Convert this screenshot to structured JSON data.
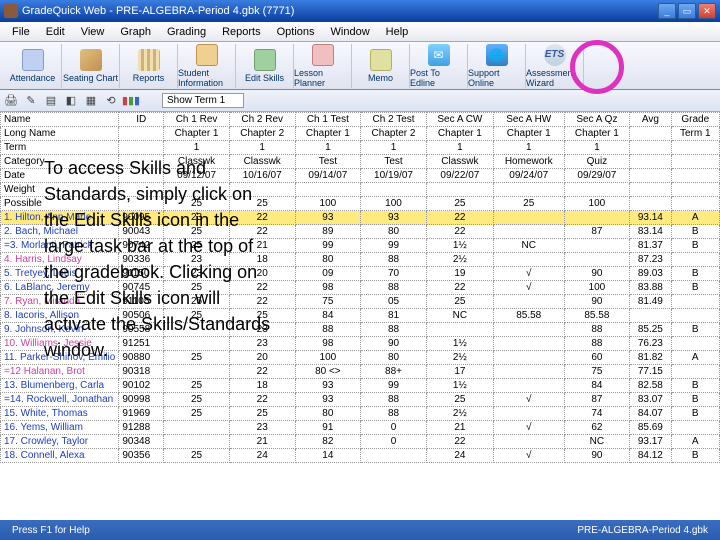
{
  "window": {
    "title": "GradeQuick Web - PRE-ALGEBRA-Period 4.gbk (7771)"
  },
  "menu": [
    "File",
    "Edit",
    "View",
    "Graph",
    "Grading",
    "Reports",
    "Options",
    "Window",
    "Help"
  ],
  "toolbar": [
    {
      "label": "Attendance",
      "icon": "cal",
      "name": "attendance-button"
    },
    {
      "label": "Seating Chart",
      "icon": "chart",
      "name": "seating-chart-button"
    },
    {
      "label": "Reports",
      "icon": "reports",
      "name": "reports-button"
    },
    {
      "label": "Student Information",
      "icon": "student",
      "name": "student-info-button"
    },
    {
      "label": "Edit Skills",
      "icon": "edit",
      "name": "edit-skills-button"
    },
    {
      "label": "Lesson Planner",
      "icon": "lesson",
      "name": "lesson-planner-button"
    },
    {
      "label": "Memo",
      "icon": "memo",
      "name": "memo-button"
    },
    {
      "label": "Post To Edline",
      "icon": "post",
      "name": "post-edline-button"
    },
    {
      "label": "Support Online",
      "icon": "support",
      "name": "support-online-button"
    },
    {
      "label": "Assessment Wizard",
      "icon": "ets",
      "name": "assessment-wizard-button"
    }
  ],
  "term_selector": "Show Term 1",
  "row_headers": [
    "Name",
    "Long Name",
    "Term",
    "Category",
    "Date",
    "Weight",
    "Possible"
  ],
  "columns": [
    "",
    "ID",
    "Ch 1 Rev",
    "Ch 2 Rev",
    "Ch 1 Test",
    "Ch 2 Test",
    "Sec A CW",
    "Sec A HW",
    "Sec A Qz",
    "Avg",
    "Grade"
  ],
  "sub_columns": [
    "",
    "",
    "Chapter 1",
    "Chapter 2",
    "Chapter 1",
    "Chapter 2",
    "Chapter 1",
    "Chapter 1",
    "Chapter 1",
    "",
    "Term 1"
  ],
  "meta_rows": [
    {
      "label": "Term",
      "cells": [
        "",
        "1",
        "1",
        "1",
        "1",
        "1",
        "1",
        "1",
        "",
        ""
      ]
    },
    {
      "label": "Category",
      "cells": [
        "",
        "Classwk",
        "Classwk",
        "Test",
        "Test",
        "Classwk",
        "Homework",
        "Quiz",
        "",
        ""
      ]
    },
    {
      "label": "Date",
      "cells": [
        "",
        "09/12/07",
        "10/16/07",
        "09/14/07",
        "10/19/07",
        "09/22/07",
        "09/24/07",
        "09/29/07",
        "",
        ""
      ]
    },
    {
      "label": "Weight",
      "cells": [
        "",
        "",
        "",
        "",
        "",
        "",
        "",
        "",
        "",
        ""
      ]
    },
    {
      "label": "Possible",
      "cells": [
        "",
        "25",
        "25",
        "100",
        "100",
        "25",
        "25",
        "100",
        "",
        ""
      ]
    }
  ],
  "students": [
    {
      "n": "1.",
      "name": "Hilton, Ann Marie",
      "id": "90095",
      "s": [
        "23",
        "22",
        "93",
        "93",
        "22",
        "",
        "",
        "93.14",
        "A"
      ],
      "hl": true
    },
    {
      "n": "2.",
      "name": "Bach, Michael",
      "id": "90043",
      "s": [
        "25",
        "22",
        "89",
        "80",
        "22",
        "",
        "87",
        "83.14",
        "B"
      ]
    },
    {
      "n": "=3.",
      "name": "Morlanti, Patrick",
      "id": "90742",
      "s": [
        "25",
        "21",
        "99",
        "99",
        "1½",
        "NC",
        "",
        "81.37",
        "B"
      ]
    },
    {
      "n": "4.",
      "name": "Harris, Lindsay",
      "id": "90336",
      "s": [
        "23",
        "18",
        "80",
        "88",
        "2½",
        "",
        "",
        "87.23",
        "",
        "pink"
      ]
    },
    {
      "n": "5.",
      "name": "Tretyey, Louis",
      "id": "91150",
      "s": [
        "23",
        "20",
        "09",
        "70",
        "19",
        "√",
        "90",
        "89.03",
        "B"
      ]
    },
    {
      "n": "6.",
      "name": "LaBlanc, Jeremy",
      "id": "90745",
      "s": [
        "25",
        "22",
        "98",
        "88",
        "22",
        "√",
        "100",
        "83.88",
        "B"
      ]
    },
    {
      "n": "7.",
      "name": "Ryan, Miranda",
      "id": "91105",
      "s": [
        "25",
        "22",
        "75",
        "05",
        "25",
        "",
        "90",
        "81.49",
        "",
        "pink"
      ]
    },
    {
      "n": "8.",
      "name": "Iacoris, Allison",
      "id": "90506",
      "s": [
        "25",
        "25",
        "84",
        "81",
        "NC",
        "85.58",
        "85.58",
        "",
        ""
      ]
    },
    {
      "n": "9.",
      "name": "Johnson, Kevin",
      "id": "90558",
      "s": [
        "",
        "23",
        "88",
        "88",
        "",
        "",
        "88",
        "85.25",
        "B"
      ]
    },
    {
      "n": "10.",
      "name": "Williams, Jessie",
      "id": "91251",
      "s": [
        "",
        "23",
        "98",
        "90",
        "1½",
        "",
        "88",
        "76.23",
        "",
        "pink"
      ]
    },
    {
      "n": "11.",
      "name": "Parker-Shinov, Emilio",
      "id": "90880",
      "s": [
        "25",
        "20",
        "100",
        "80",
        "2½",
        "",
        "60",
        "81.82",
        "A"
      ]
    },
    {
      "n": "=12",
      "name": "Halanan, Brot",
      "id": "90318",
      "s": [
        "",
        "22",
        "80 <>",
        "88+",
        "17",
        "",
        "75",
        "77.15",
        "",
        "pink"
      ]
    },
    {
      "n": "13.",
      "name": "Blumenberg, Carla",
      "id": "90102",
      "s": [
        "25",
        "18",
        "93",
        "99",
        "1½",
        "",
        "84",
        "82.58",
        "B"
      ]
    },
    {
      "n": "=14.",
      "name": "Rockwell, Jonathan",
      "id": "90998",
      "s": [
        "25",
        "22",
        "93",
        "88",
        "25",
        "√",
        "87",
        "83.07",
        "B"
      ]
    },
    {
      "n": "15.",
      "name": "White, Thomas",
      "id": "91969",
      "s": [
        "25",
        "25",
        "80",
        "88",
        "2½",
        "",
        "74",
        "84.07",
        "B"
      ]
    },
    {
      "n": "16.",
      "name": "Yems, William",
      "id": "91288",
      "s": [
        "",
        "23",
        "91",
        "0",
        "21",
        "√",
        "62",
        "85.69",
        "",
        ""
      ]
    },
    {
      "n": "17.",
      "name": "Crowley, Taylor",
      "id": "90348",
      "s": [
        "",
        "21",
        "82",
        "0",
        "22",
        "",
        "NC",
        "93.17",
        "A"
      ]
    },
    {
      "n": "18.",
      "name": "Connell, Alexa",
      "id": "90356",
      "s": [
        "25",
        "24",
        "14",
        "",
        "24",
        "√",
        "90",
        "84.12",
        "B"
      ]
    }
  ],
  "overlay_text": "To access Skills and Standards, simply click on the Edit Skills icon in the large task bar at the top of the gradebook. Clicking on the Edit Skills icon will activate the Skills/Standards window.",
  "status": {
    "left": "Press F1 for Help",
    "right": "PRE-ALGEBRA-Period 4.gbk"
  }
}
